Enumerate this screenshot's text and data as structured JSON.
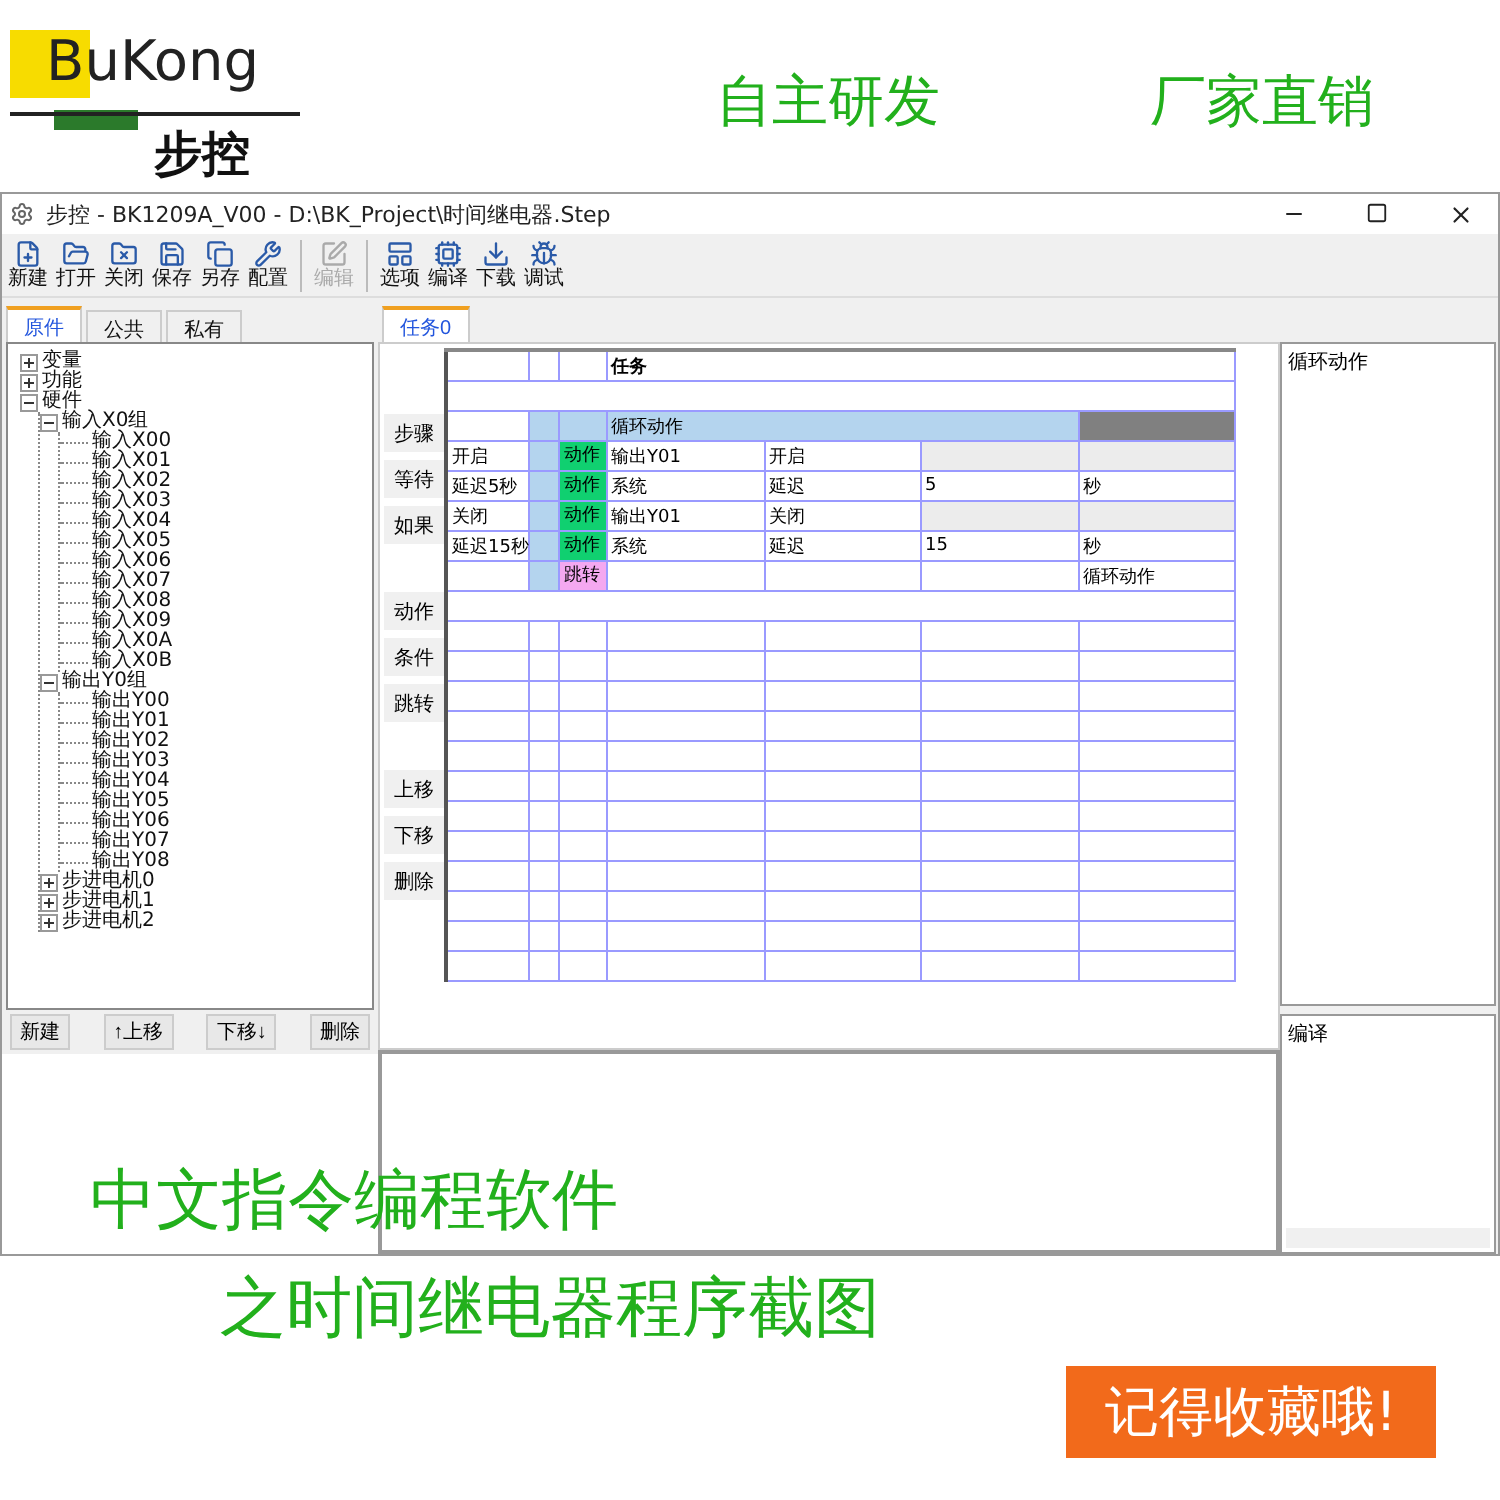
{
  "banner": {
    "logo_latin": "BuKong",
    "logo_chinese": "步控",
    "slogans": [
      "自主研发",
      "厂家直销"
    ]
  },
  "window": {
    "title": "步控  -  BK1209A_V00  -  D:\\BK_Project\\时间继电器.Step"
  },
  "toolbar": [
    [
      {
        "label": "新建",
        "disabled": false
      },
      {
        "label": "打开",
        "disabled": false
      },
      {
        "label": "关闭",
        "disabled": false
      },
      {
        "label": "保存",
        "disabled": false
      },
      {
        "label": "另存",
        "disabled": false
      },
      {
        "label": "配置",
        "disabled": false
      }
    ],
    [
      {
        "label": "编辑",
        "disabled": true
      }
    ],
    [
      {
        "label": "选项",
        "disabled": false
      },
      {
        "label": "编译",
        "disabled": false
      },
      {
        "label": "下载",
        "disabled": false
      },
      {
        "label": "调试",
        "disabled": false
      }
    ]
  ],
  "left_tabs": [
    {
      "label": "原件",
      "selected": true
    },
    {
      "label": "公共",
      "selected": false
    },
    {
      "label": "私有",
      "selected": false
    }
  ],
  "tree": [
    {
      "label": "变量",
      "expanded": false
    },
    {
      "label": "功能",
      "expanded": false
    },
    {
      "label": "硬件",
      "expanded": true,
      "children": [
        {
          "label": "输入X0组",
          "expanded": true,
          "children": [
            {
              "label": "输入X00"
            },
            {
              "label": "输入X01"
            },
            {
              "label": "输入X02"
            },
            {
              "label": "输入X03"
            },
            {
              "label": "输入X04"
            },
            {
              "label": "输入X05"
            },
            {
              "label": "输入X06"
            },
            {
              "label": "输入X07"
            },
            {
              "label": "输入X08"
            },
            {
              "label": "输入X09"
            },
            {
              "label": "输入X0A"
            },
            {
              "label": "输入X0B"
            }
          ]
        },
        {
          "label": "输出Y0组",
          "expanded": true,
          "children": [
            {
              "label": "输出Y00"
            },
            {
              "label": "输出Y01"
            },
            {
              "label": "输出Y02"
            },
            {
              "label": "输出Y03"
            },
            {
              "label": "输出Y04"
            },
            {
              "label": "输出Y05"
            },
            {
              "label": "输出Y06"
            },
            {
              "label": "输出Y07"
            },
            {
              "label": "输出Y08"
            }
          ]
        },
        {
          "label": "步进电机0",
          "expanded": false
        },
        {
          "label": "步进电机1",
          "expanded": false
        },
        {
          "label": "步进电机2",
          "expanded": false
        }
      ]
    }
  ],
  "left_buttons": [
    "新建",
    "↑上移",
    "下移↓",
    "删除"
  ],
  "editor_tabs": [
    {
      "label": "任务0",
      "selected": true
    }
  ],
  "side_buttons": [
    [
      "步骤",
      "等待",
      "如果"
    ],
    [
      "动作",
      "条件",
      "跳转"
    ],
    [
      "上移",
      "下移",
      "删除"
    ]
  ],
  "table": {
    "header": "任务",
    "step": "循环动作",
    "rows": [
      {
        "kind": "output",
        "col_1": "开启",
        "badge": "动作",
        "col_4": "输出Y01",
        "col_5": "开启",
        "col_6": "",
        "col_7": ""
      },
      {
        "kind": "delay",
        "col_1": "延迟5秒",
        "badge": "动作",
        "col_4": "系统",
        "col_5": "延迟",
        "col_6": "5",
        "col_7": "秒"
      },
      {
        "kind": "output",
        "col_1": "关闭",
        "badge": "动作",
        "col_4": "输出Y01",
        "col_5": "关闭",
        "col_6": "",
        "col_7": ""
      },
      {
        "kind": "delay",
        "col_1": "延迟15秒",
        "badge": "动作",
        "col_4": "系统",
        "col_5": "延迟",
        "col_6": "15",
        "col_7": "秒"
      },
      {
        "kind": "jump",
        "col_1": "",
        "badge": "跳转",
        "col_4": "",
        "col_5": "",
        "col_6": "",
        "col_7": "循环动作"
      }
    ]
  },
  "right_top": "循环动作",
  "right_bottom": "编译",
  "overlay": {
    "lines": [
      "中文指令编程软件",
      "之时间继电器程序截图"
    ],
    "badge": "记得收藏哦!"
  }
}
